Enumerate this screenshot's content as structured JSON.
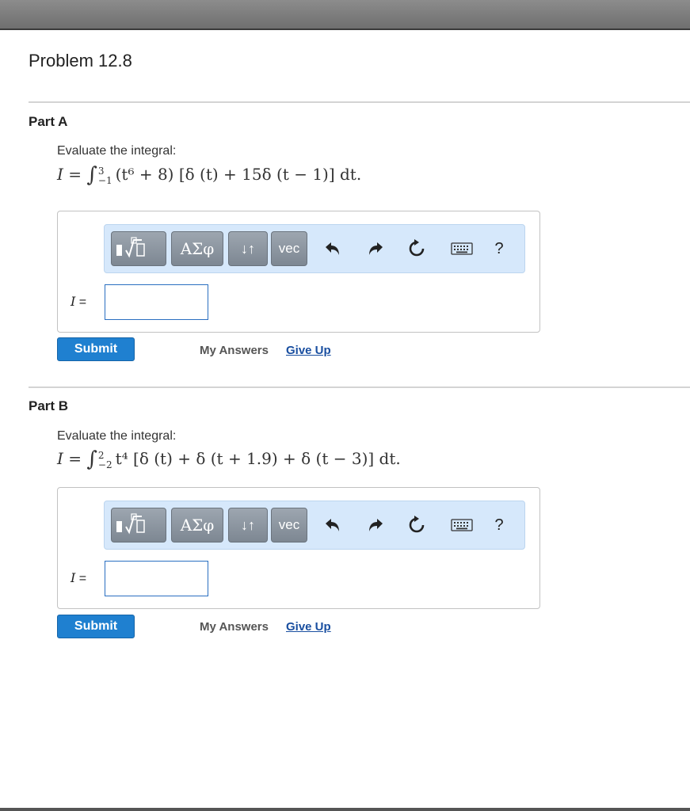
{
  "problem": {
    "title": "Problem 12.8"
  },
  "parts": [
    {
      "label": "Part A",
      "prompt": "Evaluate the integral:",
      "equation": {
        "lhs": "I = ",
        "upper": "3",
        "lower": "−1",
        "body": "(t⁶ + 8) [δ (t) + 15δ (t − 1)] dt."
      },
      "answer_label_var": "I",
      "answer_label_eq": " =",
      "answer_value": "",
      "submit_label": "Submit",
      "my_answers_label": "My Answers",
      "give_up_label": "Give Up"
    },
    {
      "label": "Part B",
      "prompt": "Evaluate the integral:",
      "equation": {
        "lhs": "I = ",
        "upper": "2",
        "lower": "−2",
        "body": "t⁴ [δ (t) + δ (t + 1.9) + δ (t − 3)] dt."
      },
      "answer_label_var": "I",
      "answer_label_eq": " =",
      "answer_value": "",
      "submit_label": "Submit",
      "my_answers_label": "My Answers",
      "give_up_label": "Give Up"
    }
  ],
  "toolbar": {
    "greek_label": "ΑΣφ",
    "arrows_label": "↓↑",
    "vec_label": "vec",
    "help_label": "?",
    "icons": [
      "templates-icon",
      "greek-symbols-icon",
      "arrows-icon",
      "vec-icon",
      "undo-icon",
      "redo-icon",
      "reset-icon",
      "keyboard-icon",
      "help-icon"
    ]
  },
  "colors": {
    "accent": "#1f80d0",
    "toolbar_bg": "#d6e8fb",
    "link": "#1a4fa0",
    "input_border": "#2a6fc1"
  }
}
